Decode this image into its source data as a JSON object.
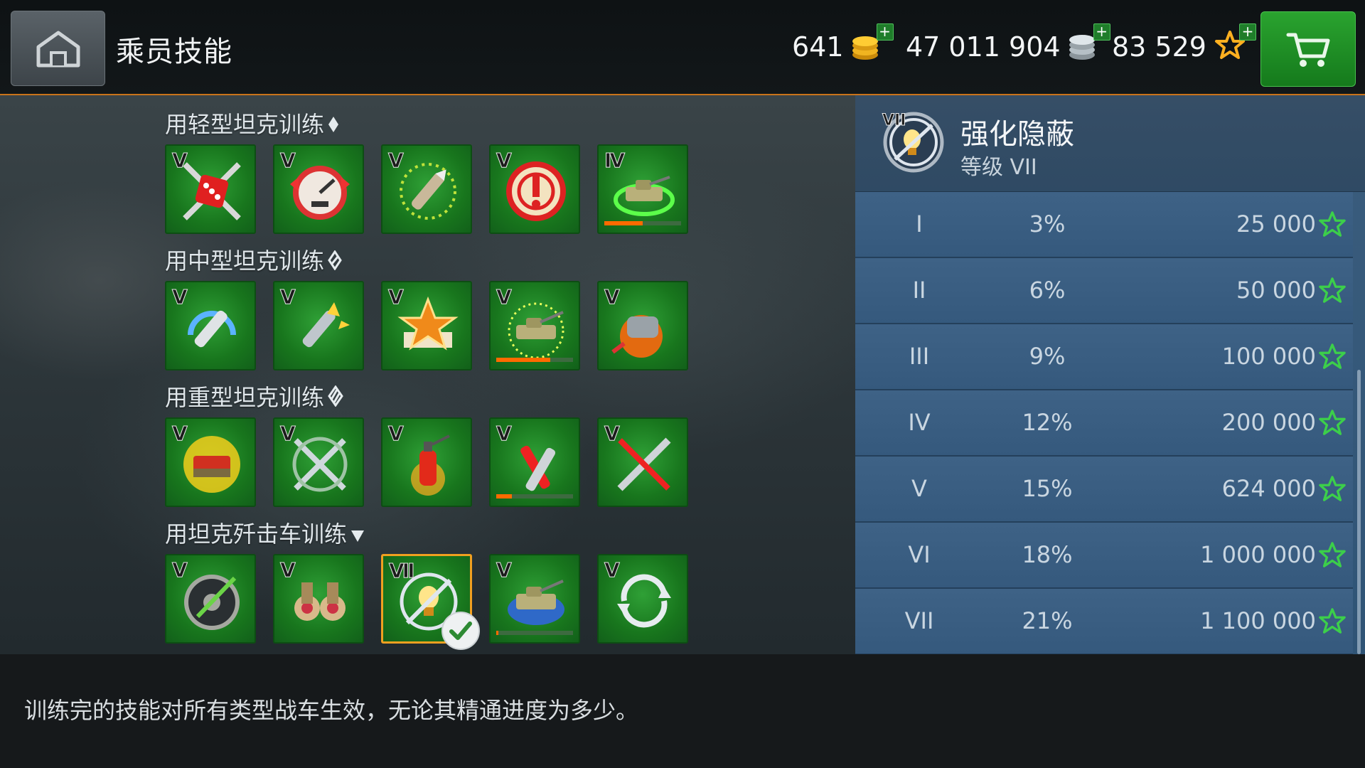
{
  "header": {
    "title": "乘员技能",
    "currencies": [
      {
        "value": "641",
        "icon": "gold-coins-icon"
      },
      {
        "value": "47 011 904",
        "icon": "silver-coins-icon"
      },
      {
        "value": "83 529",
        "icon": "star-xp-icon"
      }
    ],
    "plus_symbol": "+"
  },
  "sections": [
    {
      "label": "用轻型坦克训练",
      "class_icon": "light-tank-class-icon",
      "skills": [
        {
          "rank": "V",
          "icon": "dice-crossed-icon",
          "progress": null
        },
        {
          "rank": "V",
          "icon": "speedometer-icon",
          "progress": null
        },
        {
          "rank": "V",
          "icon": "shell-target-icon",
          "progress": null
        },
        {
          "rank": "V",
          "icon": "alert-target-icon",
          "progress": null
        },
        {
          "rank": "IV",
          "icon": "tank-green-ring-icon",
          "progress": 0.5
        }
      ]
    },
    {
      "label": "用中型坦克训练",
      "class_icon": "medium-tank-class-icon",
      "skills": [
        {
          "rank": "V",
          "icon": "shell-rotate-icon",
          "progress": null
        },
        {
          "rank": "V",
          "icon": "shell-spark-icon",
          "progress": null
        },
        {
          "rank": "V",
          "icon": "star-book-icon",
          "progress": null
        },
        {
          "rank": "V",
          "icon": "tank-yellow-ring-icon",
          "progress": 0.7
        },
        {
          "rank": "V",
          "icon": "turret-gear-icon",
          "progress": null
        }
      ]
    },
    {
      "label": "用重型坦克训练",
      "class_icon": "heavy-tank-class-icon",
      "skills": [
        {
          "rank": "V",
          "icon": "burning-armor-icon",
          "progress": null
        },
        {
          "rank": "V",
          "icon": "crossed-swords-icon",
          "progress": null
        },
        {
          "rank": "V",
          "icon": "fire-extinguisher-icon",
          "progress": null
        },
        {
          "rank": "V",
          "icon": "hammer-shell-icon",
          "progress": 0.2
        },
        {
          "rank": "V",
          "icon": "wrench-crossed-icon",
          "progress": null
        }
      ]
    },
    {
      "label": "用坦克歼击车训练",
      "class_icon": "td-class-icon",
      "skills": [
        {
          "rank": "V",
          "icon": "wheel-arrow-icon",
          "progress": null
        },
        {
          "rank": "V",
          "icon": "binoculars-icon",
          "progress": null
        },
        {
          "rank": "VII",
          "icon": "camo-bulb-icon",
          "progress": null,
          "selected": true,
          "trained": true
        },
        {
          "rank": "V",
          "icon": "tank-swap-icon",
          "progress": 0.03
        },
        {
          "rank": "V",
          "icon": "reload-cycle-icon",
          "progress": null
        }
      ]
    }
  ],
  "detail": {
    "badge_rank": "VII",
    "name": "强化隐蔽",
    "level_text": "等级 VII",
    "levels": [
      {
        "level": "I",
        "bonus": "3%",
        "cost": "25 000"
      },
      {
        "level": "II",
        "bonus": "6%",
        "cost": "50 000"
      },
      {
        "level": "III",
        "bonus": "9%",
        "cost": "100 000"
      },
      {
        "level": "IV",
        "bonus": "12%",
        "cost": "200 000"
      },
      {
        "level": "V",
        "bonus": "15%",
        "cost": "624 000"
      },
      {
        "level": "VI",
        "bonus": "18%",
        "cost": "1 000 000"
      },
      {
        "level": "VII",
        "bonus": "21%",
        "cost": "1 100 000"
      }
    ]
  },
  "description": "训练完的技能对所有类型战车生效，无论其精通进度为多少。",
  "colors": {
    "accent_orange": "#f0a020",
    "skill_green": "#1f8a26",
    "panel_blue": "#35597d",
    "progress_orange": "#ff6a00",
    "star_green": "#3ccf4a"
  }
}
